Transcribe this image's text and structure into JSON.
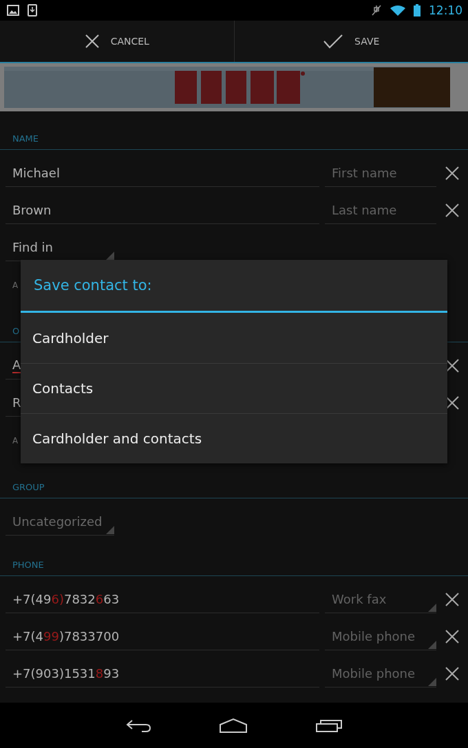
{
  "status_bar": {
    "time": "12:10"
  },
  "action_bar": {
    "buttons": [
      {
        "kind": "cancel",
        "label": "CANCEL"
      },
      {
        "kind": "save",
        "label": "SAVE"
      }
    ]
  },
  "sections": [
    {
      "header": "NAME",
      "items": [
        {
          "kind": "field",
          "value": "Michael",
          "type": "First name",
          "removable": true
        },
        {
          "kind": "field",
          "value": "Brown",
          "type": "Last name",
          "removable": true
        },
        {
          "kind": "select",
          "value": "Find in"
        },
        {
          "kind": "label",
          "text": "A"
        }
      ]
    },
    {
      "header": "O",
      "items": [
        {
          "kind": "field",
          "value": "A",
          "misspelled": true,
          "removable": true
        },
        {
          "kind": "field",
          "value": "R",
          "removable": true
        },
        {
          "kind": "label",
          "text": "A"
        }
      ]
    },
    {
      "header": "GROUP",
      "items": [
        {
          "kind": "select",
          "value": "Uncategorized"
        }
      ]
    },
    {
      "header": "PHONE",
      "items": [
        {
          "kind": "phone",
          "segments": [
            {
              "text": "+7(49",
              "flagged": false
            },
            {
              "text": "6)",
              "flagged": true
            },
            {
              "text": "7832",
              "flagged": false
            },
            {
              "text": "6",
              "flagged": true
            },
            {
              "text": "63",
              "flagged": false
            }
          ],
          "type": "Work fax",
          "removable": true
        },
        {
          "kind": "phone",
          "segments": [
            {
              "text": "+7(4",
              "flagged": false
            },
            {
              "text": "99",
              "flagged": true
            },
            {
              "text": ")7833700",
              "flagged": false
            }
          ],
          "type": "Mobile phone",
          "removable": true
        },
        {
          "kind": "phone",
          "segments": [
            {
              "text": "+7(903)1531",
              "flagged": false
            },
            {
              "text": "8",
              "flagged": true
            },
            {
              "text": "93",
              "flagged": false
            }
          ],
          "type": "Mobile phone",
          "removable": true
        }
      ]
    }
  ],
  "dialog": {
    "title": "Save contact to:",
    "options": [
      "Cardholder",
      "Contacts",
      "Cardholder and contacts"
    ]
  }
}
